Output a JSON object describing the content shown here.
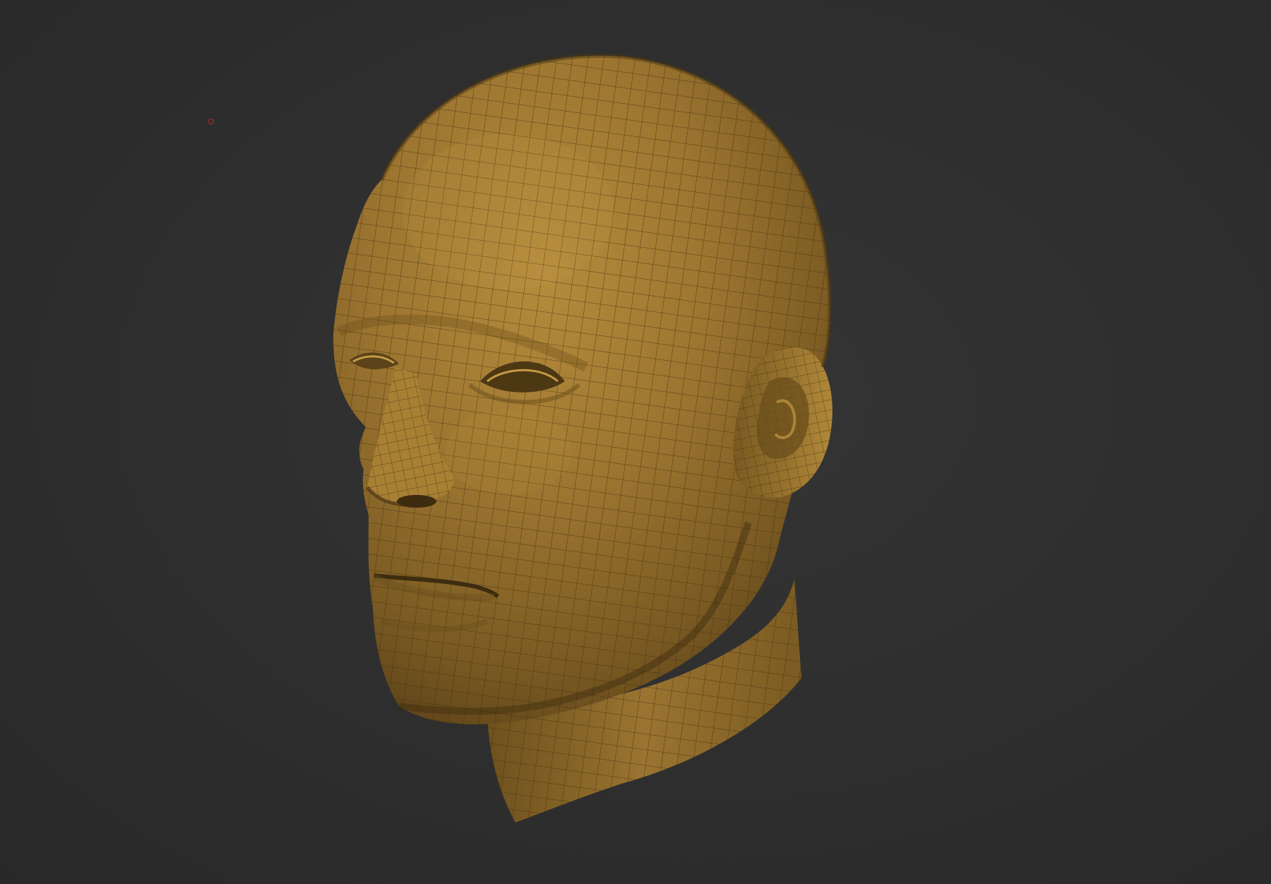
{
  "viewport": {
    "background_color": "#2e2e2e",
    "model": {
      "name": "head-mesh",
      "material_color": "#a27a30",
      "wireframe_color": "#3a2a0e"
    },
    "cursor_marker_color": "#c0262b"
  }
}
